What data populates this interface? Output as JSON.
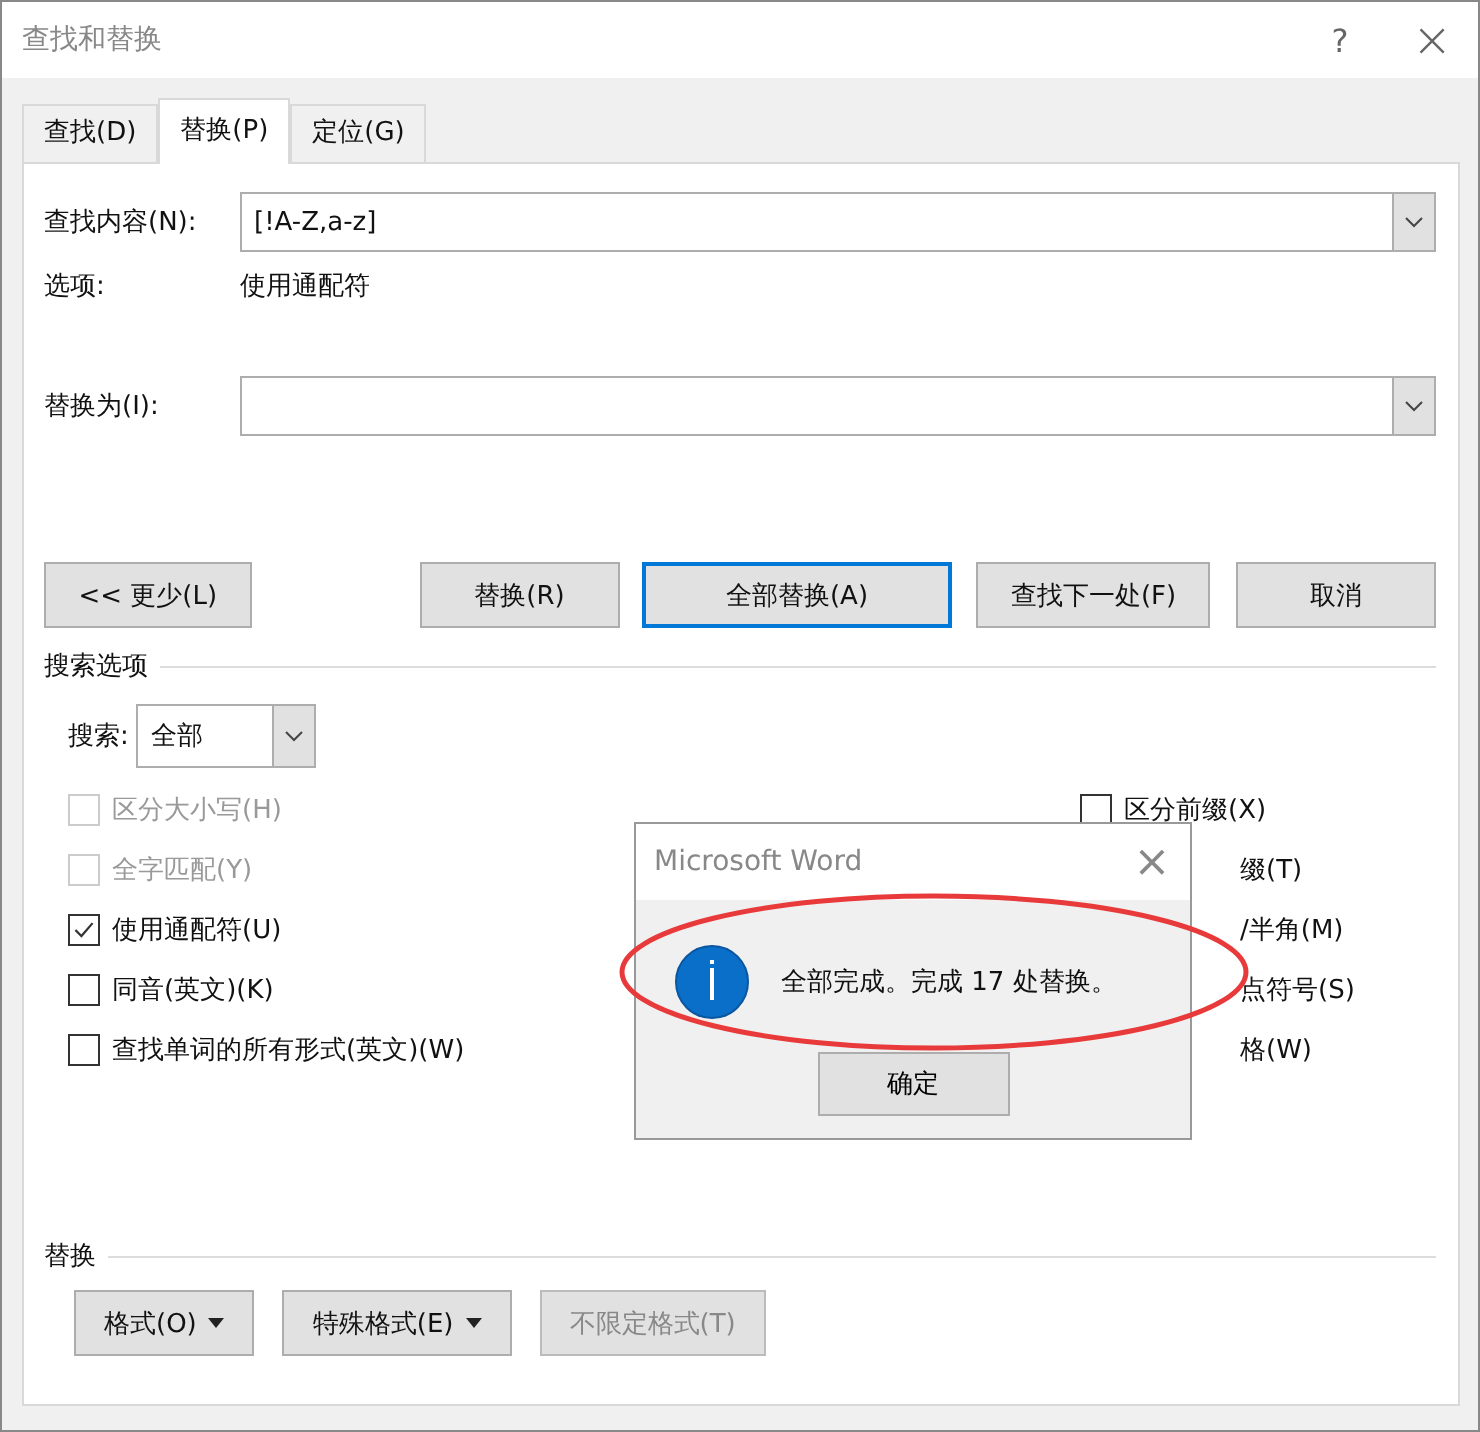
{
  "window": {
    "title": "查找和替换",
    "help": "?",
    "close": "×"
  },
  "tabs": [
    {
      "label": "查找(D)",
      "selected": false
    },
    {
      "label": "替换(P)",
      "selected": true
    },
    {
      "label": "定位(G)",
      "selected": false
    }
  ],
  "find": {
    "label": "查找内容(N):",
    "value": "[!A-Z,a-z]"
  },
  "options": {
    "label": "选项:",
    "value": "使用通配符"
  },
  "replace": {
    "label": "替换为(I):"
  },
  "buttons": [
    {
      "label": "<< 更少(L)",
      "default": false
    },
    {
      "label": "替换(R)",
      "default": false
    },
    {
      "label": "全部替换(A)",
      "default": true
    },
    {
      "label": "查找下一处(F)",
      "default": false
    },
    {
      "label": "取消",
      "default": false
    }
  ],
  "search_options": {
    "title": "搜索选项",
    "search_label": "搜索:",
    "search_value": "全部"
  },
  "left_checks": [
    {
      "label": "区分大小写(H)",
      "checked": false,
      "disabled": true
    },
    {
      "label": "全字匹配(Y)",
      "checked": false,
      "disabled": true
    },
    {
      "label": "使用通配符(U)",
      "checked": true,
      "disabled": false
    },
    {
      "label": "同音(英文)(K)",
      "checked": false,
      "disabled": false
    },
    {
      "label": "查找单词的所有形式(英文)(W)",
      "checked": false,
      "disabled": false
    }
  ],
  "right_checks": [
    {
      "label": "区分前缀(X)",
      "checked": false,
      "disabled": false
    },
    {
      "label": "缀(T)"
    },
    {
      "label": "/半角(M)"
    },
    {
      "label": "点符号(S)"
    },
    {
      "label": "格(W)"
    }
  ],
  "replace_section": {
    "title": "替换",
    "buttons": [
      {
        "label": "格式(O)",
        "disabled": false,
        "caret": true
      },
      {
        "label": "特殊格式(E)",
        "disabled": false,
        "caret": true
      },
      {
        "label": "不限定格式(T)",
        "disabled": true,
        "caret": false
      }
    ]
  },
  "message_box": {
    "title": "Microsoft Word",
    "close": "×",
    "message": "全部完成。完成 17 处替换。",
    "ok": "确定"
  }
}
